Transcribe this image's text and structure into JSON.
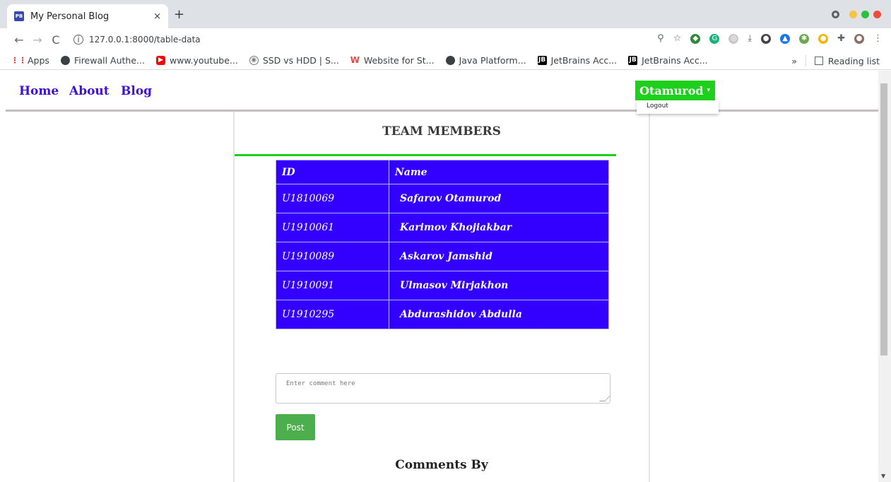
{
  "browser": {
    "tab_title": "My Personal Blog",
    "tab_favicon": "PB",
    "close_glyph": "×",
    "newtab_glyph": "+",
    "url": "127.0.0.1:8000/table-data",
    "bookmarks": [
      {
        "label": "Apps",
        "icon": "apps-grid-icon"
      },
      {
        "label": "Firewall Authe...",
        "icon": "globe-icon"
      },
      {
        "label": "www.youtube...",
        "icon": "youtube-icon"
      },
      {
        "label": "SSD vs HDD | S...",
        "icon": "disk-icon"
      },
      {
        "label": "Website for St...",
        "icon": "w-logo-icon"
      },
      {
        "label": "Java Platform...",
        "icon": "globe-icon"
      },
      {
        "label": "JetBrains Acc...",
        "icon": "jetbrains-icon"
      },
      {
        "label": "JetBrains Acc...",
        "icon": "jetbrains-icon"
      }
    ],
    "more_bookmarks": "»",
    "reading_list": "Reading list",
    "window_colors": [
      "#f6c343",
      "#2ebf3c",
      "#ee4b3f"
    ]
  },
  "nav": {
    "home": "Home",
    "about": "About",
    "blog": "Blog",
    "user": "Otamurod",
    "logout": "Logout"
  },
  "team": {
    "title": "TEAM MEMBERS",
    "columns": [
      "ID",
      "Name"
    ],
    "rows": [
      {
        "id": "U1810069",
        "name": "Safarov Otamurod"
      },
      {
        "id": "U1910061",
        "name": "Karimov Khojiakbar"
      },
      {
        "id": "U1910089",
        "name": "Askarov Jamshid"
      },
      {
        "id": "U1910091",
        "name": "Ulmasov Mirjakhon"
      },
      {
        "id": "U1910295",
        "name": "Abdurashidov Abdulla"
      }
    ]
  },
  "comment": {
    "placeholder": "Enter comment here",
    "post_label": "Post",
    "comments_by": "Comments By"
  },
  "colors": {
    "link": "#3d0ee0",
    "accent_green": "#1ed01b",
    "table_bg": "#3300ff",
    "post_btn": "#4cae4c"
  }
}
